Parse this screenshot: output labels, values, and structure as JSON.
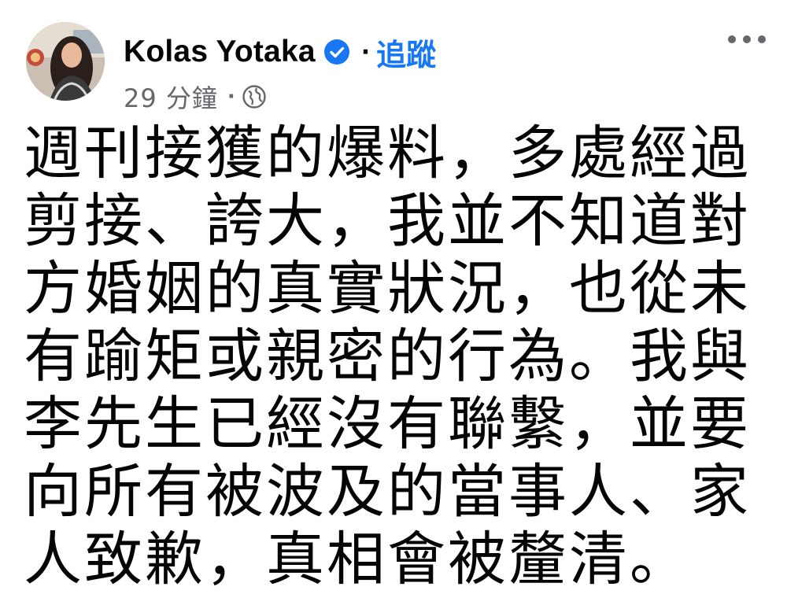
{
  "post": {
    "author": "Kolas Yotaka",
    "follow_label": "追蹤",
    "separator": "·",
    "timestamp": "29 分鐘",
    "audience_icon": "globe-icon",
    "verified_icon": "verified-badge-icon",
    "more_icon": "more-options-icon",
    "body": "週刊接獲的爆料，多處經過剪接、誇大，我並不知道對方婚姻的真實狀況，也從未有踰矩或親密的行為。我與李先生已經沒有聯繫，並要向所有被波及的當事人、家人致歉，真相會被釐清。"
  },
  "colors": {
    "link": "#1877f2",
    "secondary_text": "#65676b",
    "primary_text": "#050505"
  }
}
